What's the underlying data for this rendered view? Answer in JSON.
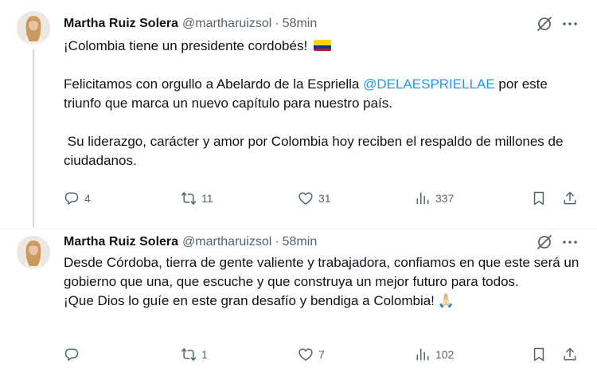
{
  "tweets": [
    {
      "author_name": "Martha Ruiz Solera",
      "handle": "@martharuizsol",
      "separator": "·",
      "time": "58min",
      "lines": [
        {
          "text": "¡Colombia tiene un presidente cordobés! "
        },
        {
          "text": ""
        },
        {
          "pre": "Felicitamos con orgullo a Abelardo de la Espriella ",
          "mention": "@DELAESPRIELLAE",
          "post": " por este triunfo que marca un nuevo capítulo para nuestro país."
        },
        {
          "text": ""
        },
        {
          "text": " Su liderazgo, carácter y amor por Colombia hoy reciben el respaldo de millones de ciudadanos."
        }
      ],
      "counts": {
        "replies": "4",
        "reposts": "11",
        "likes": "31",
        "views": "337"
      }
    },
    {
      "author_name": "Martha Ruiz Solera",
      "handle": "@martharuizsol",
      "separator": "·",
      "time": "58min",
      "lines": [
        {
          "text": "Desde Córdoba, tierra de gente valiente y trabajadora, confiamos en que este será un gobierno que una, que escuche y que construya un mejor futuro para todos."
        },
        {
          "text": "¡Que Dios lo guíe en este gran desafío y bendiga a Colombia!"
        }
      ],
      "emoji": "🙏🏻",
      "counts": {
        "replies": "",
        "reposts": "1",
        "likes": "7",
        "views": "102"
      }
    }
  ],
  "icons": [
    "avatar",
    "flag-colombia-icon",
    "grok-icon",
    "more-icon",
    "reply-icon",
    "repost-icon",
    "like-icon",
    "views-icon",
    "bookmark-icon",
    "share-icon",
    "praying-hands-emoji"
  ],
  "colors": {
    "text": "#0f1419",
    "secondary": "#536471",
    "link": "#1d9bf0",
    "divider": "#eff3f4",
    "thread_line": "#cfd9de"
  }
}
